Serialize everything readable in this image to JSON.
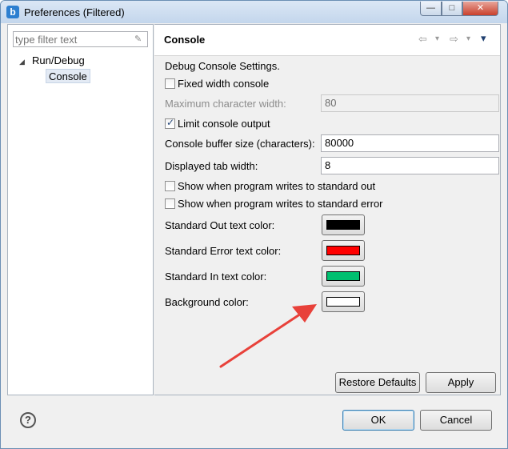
{
  "window": {
    "title": "Preferences (Filtered)",
    "app_icon_letter": "b"
  },
  "sidebar": {
    "filter_placeholder": "type filter text",
    "tree": [
      {
        "label": "Run/Debug",
        "expanded": true
      },
      {
        "label": "Console",
        "selected": true
      }
    ]
  },
  "page": {
    "title": "Console",
    "nav": {
      "back": "⇦",
      "forward": "⇨",
      "menu": "▾"
    },
    "section_label": "Debug Console Settings.",
    "fixed_width": {
      "label": "Fixed width console",
      "checked": false
    },
    "max_char_width": {
      "label": "Maximum character width:",
      "value": "80",
      "enabled": false
    },
    "limit_output": {
      "label": "Limit console output",
      "checked": true
    },
    "buffer_size": {
      "label": "Console buffer size (characters):",
      "value": "80000"
    },
    "tab_width": {
      "label": "Displayed tab width:",
      "value": "8"
    },
    "show_stdout": {
      "label": "Show when program writes to standard out",
      "checked": false
    },
    "show_stderr": {
      "label": "Show when program writes to standard error",
      "checked": false
    },
    "colors": [
      {
        "label": "Standard Out text color:",
        "color": "#000000"
      },
      {
        "label": "Standard Error text color:",
        "color": "#ff0000"
      },
      {
        "label": "Standard In text color:",
        "color": "#00c070"
      },
      {
        "label": "Background color:",
        "color": "#ffffff"
      }
    ],
    "restore_defaults_label": "Restore Defaults",
    "apply_label": "Apply"
  },
  "footer": {
    "help_label": "?",
    "ok_label": "OK",
    "cancel_label": "Cancel"
  },
  "annotation": {
    "arrow_color": "#e8413a"
  }
}
